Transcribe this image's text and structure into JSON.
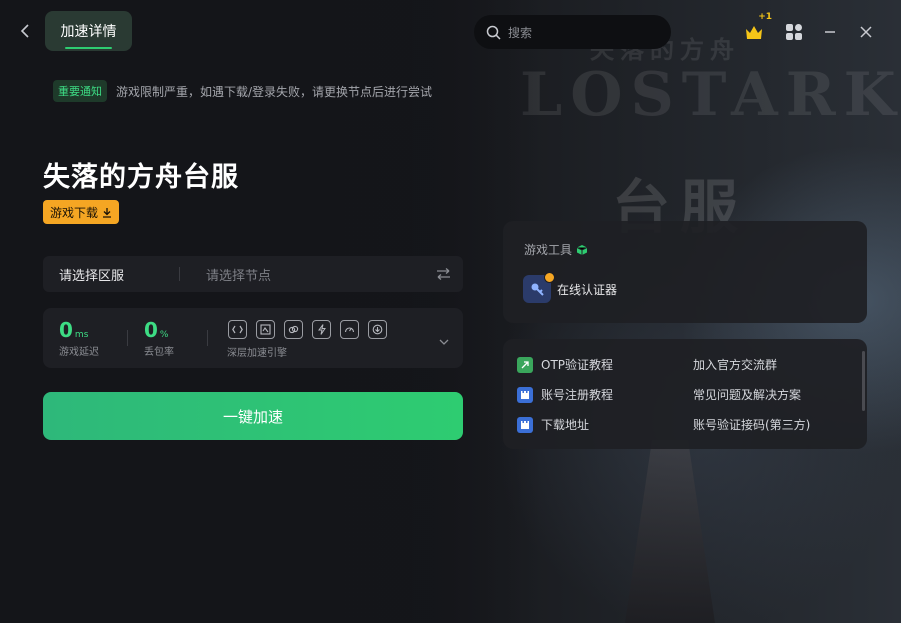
{
  "window": {
    "tab_active": "加速详情"
  },
  "search": {
    "placeholder": "搜索"
  },
  "header": {
    "badge_text": "+1"
  },
  "background_art": {
    "title_cn": "失落的方舟",
    "logo": "LOSTARK",
    "region": "台服"
  },
  "notice": {
    "tag": "重要通知",
    "text": "游戏限制严重，如遇下载/登录失败，请更换节点后进行尝试"
  },
  "game": {
    "title": "失落的方舟台服",
    "download_label": "游戏下载"
  },
  "selector": {
    "region_label": "请选择区服",
    "node_placeholder": "请选择节点"
  },
  "stats": {
    "latency_value": "0",
    "latency_unit": "ms",
    "latency_label": "游戏延迟",
    "loss_value": "0",
    "loss_unit": "%",
    "loss_label": "丢包率",
    "engine_label": "深层加速引擎"
  },
  "accelerate": {
    "label": "一键加速"
  },
  "tools": {
    "heading": "游戏工具",
    "items": [
      {
        "label": "在线认证器"
      }
    ]
  },
  "links": {
    "left": [
      {
        "label": "OTP验证教程"
      },
      {
        "label": "账号注册教程"
      },
      {
        "label": "下载地址"
      }
    ],
    "right": [
      {
        "label": "加入官方交流群"
      },
      {
        "label": "常见问题及解决方案"
      },
      {
        "label": "账号验证接码(第三方)"
      }
    ]
  },
  "colors": {
    "accent": "#2ecc71",
    "warning": "#f5a623",
    "panel": "#1e1f24"
  }
}
